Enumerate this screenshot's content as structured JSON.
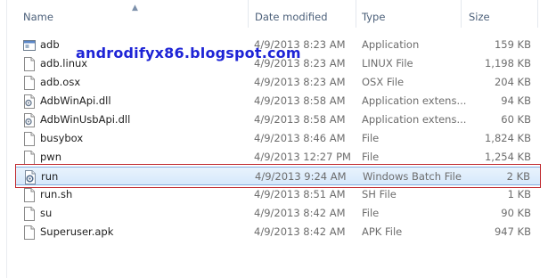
{
  "columns": {
    "name": "Name",
    "date": "Date modified",
    "type": "Type",
    "size": "Size"
  },
  "watermark": "androdifyx86.blogspot.com",
  "files": [
    {
      "name": "adb",
      "date": "4/9/2013 8:23 AM",
      "type": "Application",
      "size": "159 KB",
      "icon": "application-icon"
    },
    {
      "name": "adb.linux",
      "date": "4/9/2013 8:23 AM",
      "type": "LINUX File",
      "size": "1,198 KB",
      "icon": "file-icon"
    },
    {
      "name": "adb.osx",
      "date": "4/9/2013 8:23 AM",
      "type": "OSX File",
      "size": "204 KB",
      "icon": "file-icon"
    },
    {
      "name": "AdbWinApi.dll",
      "date": "4/9/2013 8:58 AM",
      "type": "Application extens...",
      "size": "94 KB",
      "icon": "dll-icon"
    },
    {
      "name": "AdbWinUsbApi.dll",
      "date": "4/9/2013 8:58 AM",
      "type": "Application extens...",
      "size": "60 KB",
      "icon": "dll-icon"
    },
    {
      "name": "busybox",
      "date": "4/9/2013 8:46 AM",
      "type": "File",
      "size": "1,824 KB",
      "icon": "file-icon"
    },
    {
      "name": "pwn",
      "date": "4/9/2013 12:27 PM",
      "type": "File",
      "size": "1,254 KB",
      "icon": "file-icon"
    },
    {
      "name": "run",
      "date": "4/9/2013 9:24 AM",
      "type": "Windows Batch File",
      "size": "2 KB",
      "icon": "batch-icon",
      "selected": true
    },
    {
      "name": "run.sh",
      "date": "4/9/2013 8:51 AM",
      "type": "SH File",
      "size": "1 KB",
      "icon": "file-icon"
    },
    {
      "name": "su",
      "date": "4/9/2013 8:42 AM",
      "type": "File",
      "size": "90 KB",
      "icon": "file-icon"
    },
    {
      "name": "Superuser.apk",
      "date": "4/9/2013 8:42 AM",
      "type": "APK File",
      "size": "947 KB",
      "icon": "file-icon"
    }
  ],
  "colors": {
    "selection_border": "#84acdd",
    "highlight_box": "#c0282e",
    "watermark": "#1e24d6",
    "header_text": "#4c607a"
  }
}
